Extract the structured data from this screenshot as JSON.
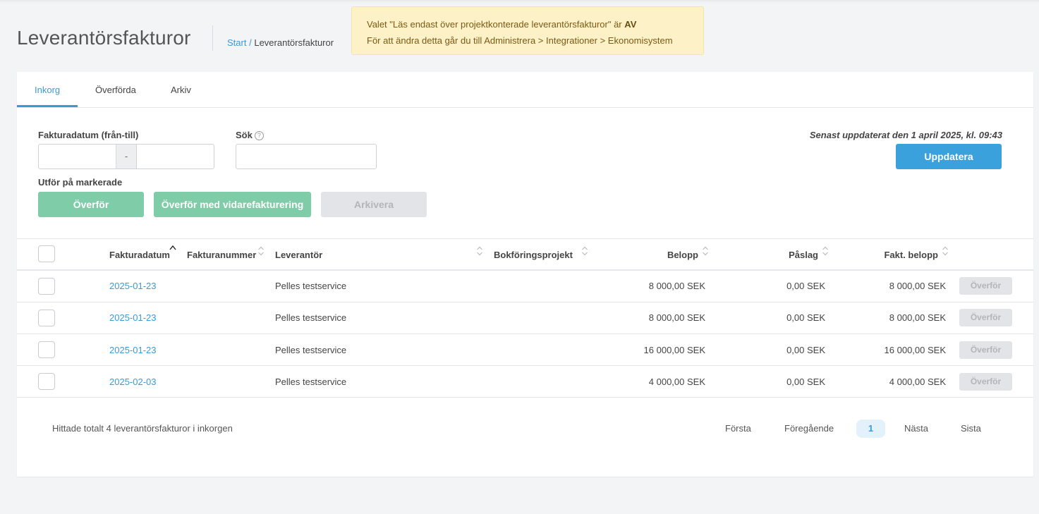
{
  "page": {
    "title": "Leverantörsfakturor",
    "breadcrumb": {
      "start": "Start",
      "separator": "/",
      "current": "Leverantörsfakturor"
    }
  },
  "notice": {
    "line1_prefix": "Valet \"Läs endast över projektkonterade leverantörsfakturor\" är",
    "line1_value": "AV",
    "line2": "För att ändra detta går du till Administrera > Integrationer > Ekonomisystem"
  },
  "tabs": [
    {
      "label": "Inkorg",
      "active": true
    },
    {
      "label": "Överförda",
      "active": false
    },
    {
      "label": "Arkiv",
      "active": false
    }
  ],
  "filters": {
    "date_label": "Fakturadatum (från-till)",
    "date_from": "",
    "date_separator": "-",
    "date_to": "",
    "search_label": "Sök",
    "search_value": "",
    "help_glyph": "?"
  },
  "updated_text": "Senast uppdaterat den 1 april 2025, kl. 09:43",
  "update_button": "Uppdatera",
  "bulk": {
    "label": "Utför på markerade",
    "transfer": "Överför",
    "transfer_rebill": "Överför med vidarefakturering",
    "archive": "Arkivera"
  },
  "table": {
    "columns": {
      "date": "Fakturadatum",
      "number": "Fakturanummer",
      "supplier": "Leverantör",
      "project": "Bokföringsprojekt",
      "amount": "Belopp",
      "markup": "Påslag",
      "invoiced": "Fakt. belopp"
    },
    "sorted_column": "date",
    "rows": [
      {
        "date": "2025-01-23",
        "number": "",
        "supplier": "Pelles testservice",
        "project": "",
        "amount": "8 000,00 SEK",
        "markup": "0,00 SEK",
        "invoiced": "8 000,00 SEK",
        "action": "Överför"
      },
      {
        "date": "2025-01-23",
        "number": "",
        "supplier": "Pelles testservice",
        "project": "",
        "amount": "8 000,00 SEK",
        "markup": "0,00 SEK",
        "invoiced": "8 000,00 SEK",
        "action": "Överför"
      },
      {
        "date": "2025-01-23",
        "number": "",
        "supplier": "Pelles testservice",
        "project": "",
        "amount": "16 000,00 SEK",
        "markup": "0,00 SEK",
        "invoiced": "16 000,00 SEK",
        "action": "Överför"
      },
      {
        "date": "2025-02-03",
        "number": "",
        "supplier": "Pelles testservice",
        "project": "",
        "amount": "4 000,00 SEK",
        "markup": "0,00 SEK",
        "invoiced": "4 000,00 SEK",
        "action": "Överför"
      }
    ]
  },
  "footer": {
    "total_text": "Hittade totalt 4 leverantörsfakturor i inkorgen",
    "pagination": {
      "first": "Första",
      "prev": "Föregående",
      "current": "1",
      "next": "Nästa",
      "last": "Sista"
    }
  },
  "colors": {
    "accent": "#3a9ad9",
    "primary_button": "#3aa1dd",
    "success_button": "#7fcca8",
    "notice_bg": "#fdf1c8"
  }
}
